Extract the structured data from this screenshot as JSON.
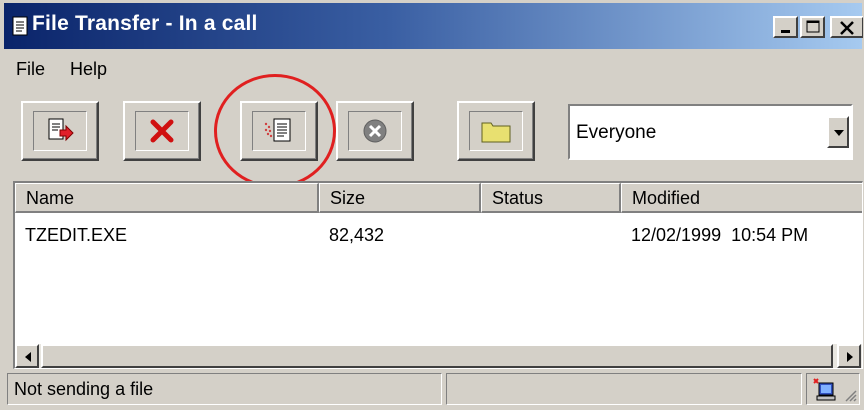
{
  "window": {
    "title": "File Transfer - In a call",
    "title_icon": "document-icon",
    "controls": [
      "minimize-icon",
      "maximize-icon",
      "close-icon"
    ]
  },
  "menu": {
    "items": [
      {
        "label": "File"
      },
      {
        "label": "Help"
      }
    ]
  },
  "toolbar": {
    "buttons": [
      {
        "name": "send-file-button",
        "icon": "send-file-icon"
      },
      {
        "name": "remove-file-button",
        "icon": "red-x-icon"
      },
      {
        "name": "send-all-button",
        "icon": "send-all-icon",
        "highlighted": true
      },
      {
        "name": "cancel-transfer-button",
        "icon": "stop-circle-icon"
      },
      {
        "name": "open-received-folder-button",
        "icon": "folder-icon"
      }
    ],
    "recipient": {
      "selected": "Everyone"
    },
    "highlight_color": "#e02020"
  },
  "list": {
    "columns": [
      "Name",
      "Size",
      "Status",
      "Modified"
    ],
    "rows": [
      {
        "name": "TZEDIT.EXE",
        "size": "82,432",
        "status": "",
        "modified": "12/02/1999  10:54 PM"
      }
    ]
  },
  "status": {
    "text": "Not sending a file",
    "icon": "network-transfer-icon"
  },
  "colors": {
    "titlebar_start": "#0a246a",
    "titlebar_end": "#a6caf0",
    "face": "#d4d0c8"
  }
}
